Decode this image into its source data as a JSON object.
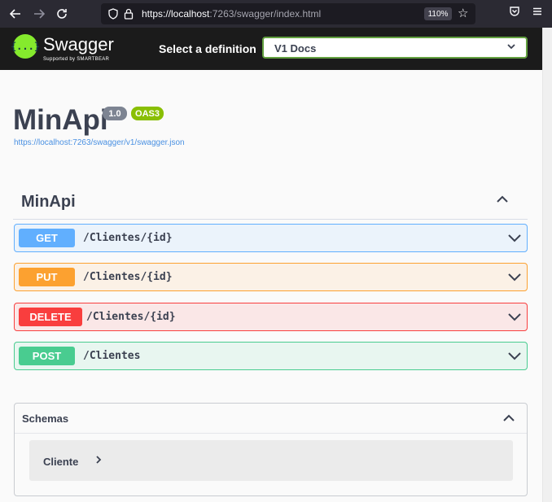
{
  "browser": {
    "url_host": "https://localhost",
    "url_rest": ":7263/swagger/index.html",
    "zoom": "110%"
  },
  "topbar": {
    "logo_glyph": "{...}",
    "logo_name": "Swagger",
    "logo_tagline": "Supported by SMARTBEAR",
    "definition_label": "Select a definition",
    "definition_selected": "V1 Docs"
  },
  "info": {
    "title": "MinApi",
    "version": "1.0",
    "oas_badge": "OAS3",
    "spec_url": "https://localhost:7263/swagger/v1/swagger.json"
  },
  "tag": {
    "name": "MinApi",
    "operations": [
      {
        "method": "GET",
        "path": "/Clientes/{id}"
      },
      {
        "method": "PUT",
        "path": "/Clientes/{id}"
      },
      {
        "method": "DELETE",
        "path": "/Clientes/{id}"
      },
      {
        "method": "POST",
        "path": "/Clientes"
      }
    ]
  },
  "schemas": {
    "title": "Schemas",
    "models": [
      {
        "name": "Cliente"
      }
    ]
  },
  "colors": {
    "get": "#61affe",
    "put": "#fca130",
    "delete": "#f93e3e",
    "post": "#49cc90",
    "brand": "#85ea2d"
  }
}
